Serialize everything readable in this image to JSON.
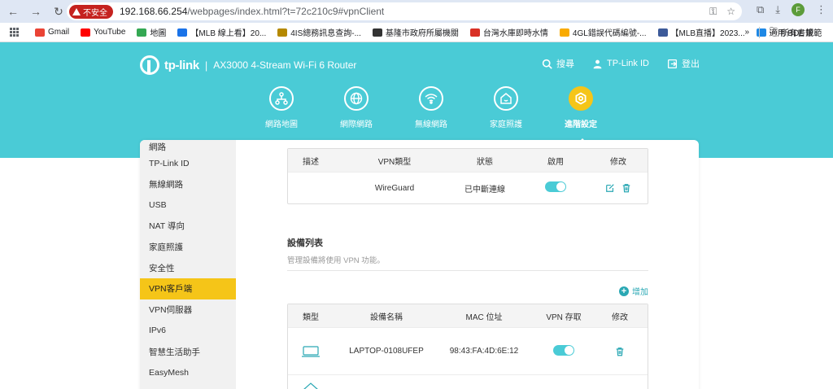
{
  "browser": {
    "insecure_label": "不安全",
    "url_host": "192.168.66.254",
    "url_path": "/webpages/index.html?t=72c210c9#vpnClient",
    "bookmarks": [
      {
        "label": "Gmail",
        "color": "#ea4335"
      },
      {
        "label": "YouTube",
        "color": "#ff0000"
      },
      {
        "label": "地圖",
        "color": "#34a853"
      },
      {
        "label": "【MLB 線上看】20...",
        "color": "#1a73e8"
      },
      {
        "label": "4IS總務訊息查詢-...",
        "color": "#b58900"
      },
      {
        "label": "基隆市政府所屬機關",
        "color": "#333333"
      },
      {
        "label": "台灣水庫即時水情",
        "color": "#d93025"
      },
      {
        "label": "4GL錯誤代碼編號-...",
        "color": "#f9ab00"
      },
      {
        "label": "【MLB直播】2023...",
        "color": "#3c5a99"
      },
      {
        "label": "適用 BDL 規範",
        "color": "#1e88e5"
      }
    ],
    "more_label": "»",
    "all_bookmarks": "所有書籤",
    "profile_initial": "F"
  },
  "header": {
    "brand": "tp-link",
    "model": "AX3000 4-Stream Wi-Fi 6 Router",
    "links": [
      {
        "label": "搜尋",
        "icon": "search-icon"
      },
      {
        "label": "TP-Link ID",
        "icon": "tplink-id-icon"
      },
      {
        "label": "登出",
        "icon": "logout-icon"
      }
    ],
    "tabs": [
      {
        "label": "網路地圖",
        "icon": "network-map-icon"
      },
      {
        "label": "網際網路",
        "icon": "internet-icon"
      },
      {
        "label": "無線網路",
        "icon": "wifi-icon"
      },
      {
        "label": "家庭照護",
        "icon": "home-care-icon"
      },
      {
        "label": "進階設定",
        "icon": "advanced-settings-icon",
        "active": true
      }
    ]
  },
  "sidebar": {
    "items": [
      "網路",
      "TP-Link ID",
      "無線網路",
      "USB",
      "NAT 導向",
      "家庭照護",
      "安全性",
      "VPN客戶端",
      "VPN伺服器",
      "IPv6",
      "智慧生活助手",
      "EasyMesh"
    ],
    "active_index": 7
  },
  "vpn_table": {
    "headers": [
      "描述",
      "VPN類型",
      "狀態",
      "啟用",
      "修改"
    ],
    "rows": [
      {
        "desc": "",
        "type": "WireGuard",
        "status": "已中斷連線",
        "enabled": true
      }
    ]
  },
  "device_list": {
    "title": "設備列表",
    "description": "管理設備將使用 VPN 功能。",
    "add_label": "增加",
    "headers": [
      "類型",
      "設備名稱",
      "MAC 位址",
      "VPN 存取",
      "修改"
    ],
    "rows": [
      {
        "type_icon": "laptop-icon",
        "name": "LAPTOP-0108UFEP",
        "mac": "98:43:FA:4D:6E:12",
        "vpn_access": true
      }
    ]
  },
  "colors": {
    "accent": "#4acbd6",
    "active": "#f5c518",
    "link": "#2aa8b4"
  }
}
